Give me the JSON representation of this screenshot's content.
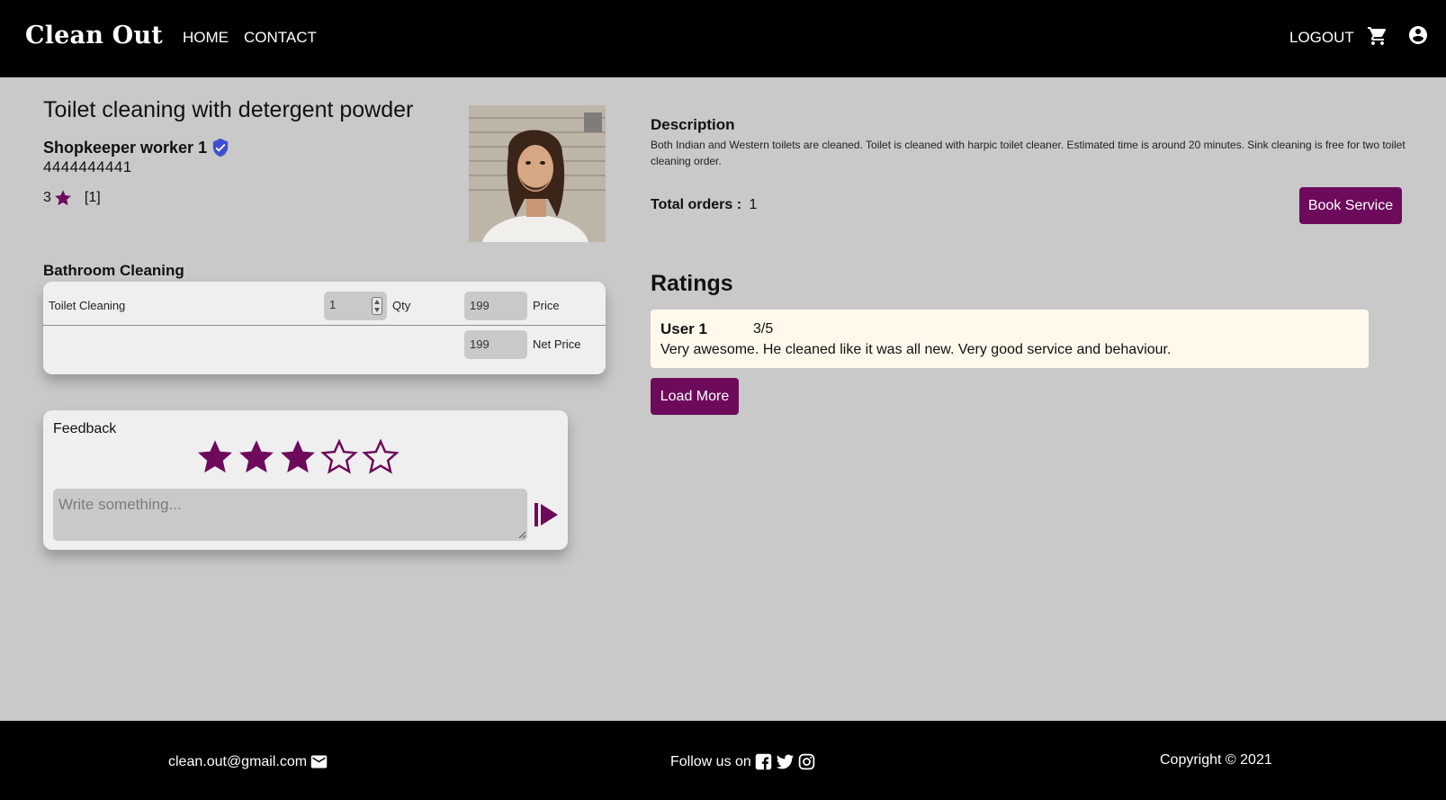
{
  "navbar": {
    "brand": "Clean Out",
    "links": {
      "home": "HOME",
      "contact": "CONTACT",
      "logout": "LOGOUT"
    },
    "icons": {
      "cart": "cart-icon",
      "account": "account-circle-icon"
    }
  },
  "service": {
    "title": "Toilet cleaning with detergent powder",
    "worker_name": "Shopkeeper worker 1",
    "phone": "4444444441",
    "rating": "3",
    "rating_count": "[1]"
  },
  "category": {
    "title": "Bathroom Cleaning",
    "items": [
      {
        "name": "Toilet Cleaning",
        "qty": "1",
        "qty_label": "Qty",
        "price": "199",
        "price_label": "Price"
      }
    ],
    "net_price": "199",
    "net_price_label": "Net Price"
  },
  "feedback": {
    "title": "Feedback",
    "selected_stars": 3,
    "total_stars": 5,
    "placeholder": "Write something..."
  },
  "description": {
    "heading": "Description",
    "text": "Both Indian and Western toilets are cleaned. Toilet is cleaned with harpic toilet cleaner. Estimated time is around 20 minutes. Sink cleaning is free for two toilet cleaning order.",
    "orders_label": "Total orders :",
    "orders_value": "1",
    "book_button": "Book Service"
  },
  "ratings": {
    "heading": "Ratings",
    "reviews": [
      {
        "user": "User 1",
        "score": "3/5",
        "text": "Very awesome. He cleaned like it was all new. Very good service and behaviour."
      }
    ],
    "load_more": "Load More"
  },
  "footer": {
    "email": "clean.out@gmail.com",
    "follow": "Follow us on",
    "copyright": "Copyright © 2021"
  },
  "colors": {
    "accent": "#6e0a5b",
    "background": "#c9c9c9",
    "nav": "#000000",
    "verified": "#3f4fd1",
    "review_card": "#fff9ec"
  }
}
